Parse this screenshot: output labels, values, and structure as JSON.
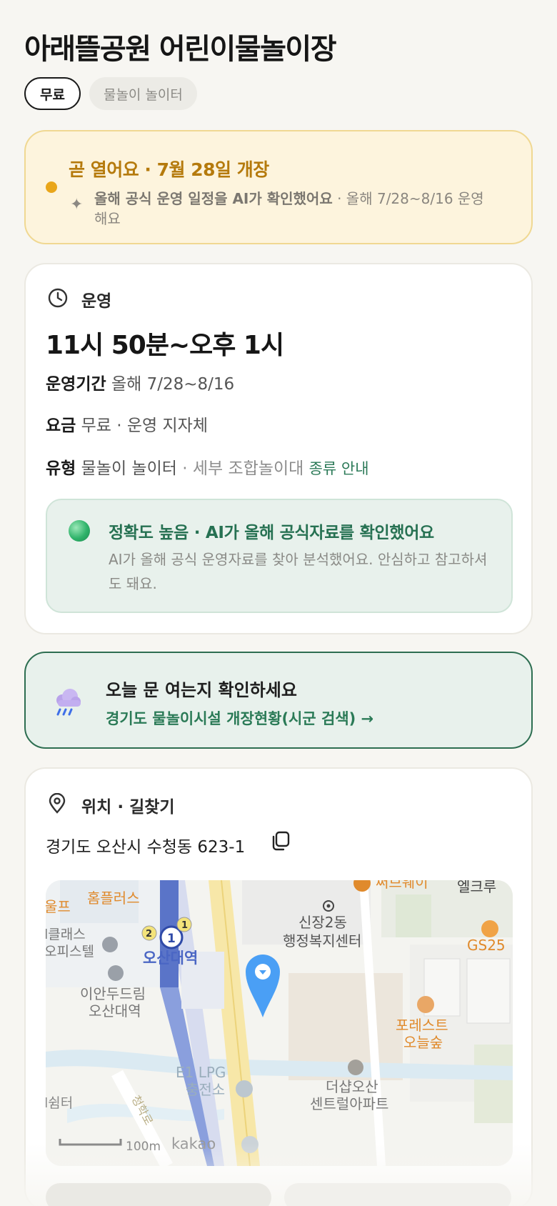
{
  "place": {
    "title": "아래뜰공원 어린이물놀이장",
    "tags": [
      "무료",
      "물놀이 놀이터"
    ]
  },
  "notice": {
    "headline": "곧 열어요 · 7월 28일 개장",
    "ai_confirm": "올해 공식 운영 일정을 AI가 확인했어요",
    "detail": " · 올해 7/28~8/16 운영해요",
    "accent_color": "#e9a61a"
  },
  "operation": {
    "section_title": "운영",
    "hours": "11시 50분~오후 1시",
    "period_label": "운영기간",
    "period_value": "올해 7/28~8/16",
    "fee_label": "요금",
    "fee_value": "무료 · 운영 지자체",
    "type_label": "유형",
    "type_value": "물놀이 놀이터",
    "type_detail": " · 세부 조합놀이대",
    "type_link": "종류 안내",
    "accuracy": {
      "title": "정확도 높음 · AI가 올해 공식자료를 확인했어요",
      "body": "AI가 올해 공식 운영자료를 찾아 분석했어요. 안심하고 참고하셔도 돼요."
    }
  },
  "open_check": {
    "title": "오늘 문 여는지 확인하세요",
    "link": "경기도 물놀이시설 개장현황(시군 검색) →"
  },
  "location": {
    "section_title": "위치 · 길찾기",
    "address": "경기도 오산시 수청동 623-1",
    "map": {
      "labels": {
        "homeplus": "홈플러스",
        "golf": "울프",
        "class1": "l클래스",
        "class2": "오피스텔",
        "station": "오산대역",
        "iandu1": "이안두드림",
        "iandu2": "오산대역",
        "sinjang1": "신장2동",
        "sinjang2": "행정복지센터",
        "subway": "써브웨이",
        "elk": "엘크루",
        "gs": "GS25",
        "forest1": "포레스트",
        "forest2": "오늘숲",
        "lpg1": "E1 LPG",
        "lpg2": "충전소",
        "shelter": "l쉼터",
        "road": "청학로",
        "apt1": "더샵오산",
        "apt2": "센트럴아파트",
        "scale": "100m",
        "provider": "kakao",
        "line1": "1",
        "line2": "2"
      }
    }
  }
}
